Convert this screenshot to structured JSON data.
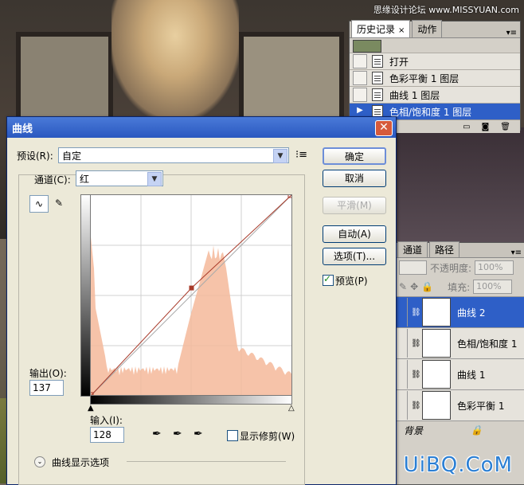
{
  "watermarks": {
    "top": "思缘设计论坛 www.MISSYUAN.com",
    "bottom": "UiBQ.CoM"
  },
  "history_panel": {
    "tabs": [
      "历史记录",
      "动作"
    ],
    "close_glyph": "×",
    "items": [
      {
        "label": "打开",
        "selected": false
      },
      {
        "label": "色彩平衡 1 图层",
        "selected": false
      },
      {
        "label": "曲线 1 图层",
        "selected": false
      },
      {
        "label": "色相/饱和度 1 图层",
        "selected": true
      }
    ]
  },
  "layers_panel": {
    "tabs": [
      "通道",
      "路径"
    ],
    "opacity_label": "不透明度:",
    "opacity_value": "100%",
    "fill_label": "填充:",
    "fill_value": "100%",
    "layers": [
      {
        "name": "曲线 2",
        "selected": true
      },
      {
        "name": "色相/饱和度 1",
        "selected": false
      },
      {
        "name": "曲线 1",
        "selected": false
      },
      {
        "name": "色彩平衡 1",
        "selected": false
      }
    ],
    "background_layer": "背景"
  },
  "curves_dialog": {
    "title": "曲线",
    "close_glyph": "✕",
    "preset_label": "预设(R):",
    "preset_value": "自定",
    "channel_label": "通道(C):",
    "channel_value": "红",
    "buttons": {
      "ok": "确定",
      "cancel": "取消",
      "smooth": "平滑(M)",
      "auto": "自动(A)",
      "options": "选项(T)..."
    },
    "preview_label": "预览(P)",
    "preview_checked": true,
    "output_label": "输出(O):",
    "output_value": "137",
    "input_label": "输入(I):",
    "input_value": "128",
    "show_clipping_label": "显示修剪(W)",
    "show_clipping_checked": false,
    "curve_options_label": "曲线显示选项",
    "curve_point": {
      "input": 128,
      "output": 137
    },
    "histogram_color": "#f4b89a",
    "curve_color": "#a83a2a"
  }
}
